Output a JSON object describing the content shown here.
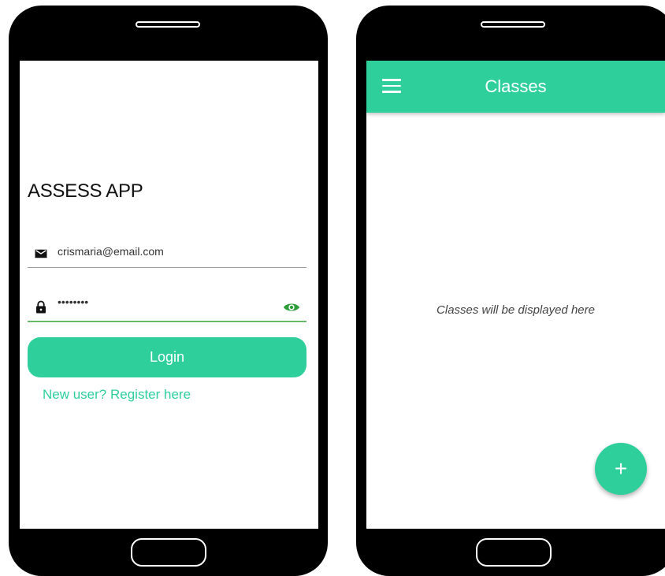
{
  "login_screen": {
    "app_title": "ASSESS APP",
    "email": {
      "icon": "mail-icon",
      "value": "crismaria@email.com"
    },
    "password": {
      "icon": "lock-icon",
      "value": "••••••••",
      "visibility_icon": "eye-icon"
    },
    "login_label": "Login",
    "register_link": "New user? Register here"
  },
  "classes_screen": {
    "title": "Classes",
    "menu_icon": "menu-icon",
    "empty_message": "Classes will be displayed here",
    "fab_label": "+"
  },
  "colors": {
    "accent": "#2ecf9b",
    "focus_underline": "#66bb6a",
    "eye_icon": "#2e9e3a",
    "frame": "#000000"
  }
}
